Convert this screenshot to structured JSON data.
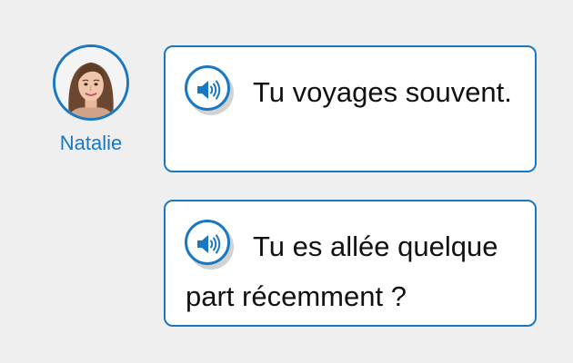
{
  "speaker": {
    "name": "Natalie",
    "avatar_icon": "woman-portrait-avatar"
  },
  "messages": [
    {
      "text": "Tu voyages souvent.",
      "audio_icon": "speaker-volume-icon"
    },
    {
      "text": "Tu es allée quelque part récemment ?",
      "audio_icon": "speaker-volume-icon"
    }
  ],
  "colors": {
    "accent": "#1a78c2",
    "background": "#efefef",
    "bubble_bg": "#ffffff",
    "text": "#111111"
  }
}
